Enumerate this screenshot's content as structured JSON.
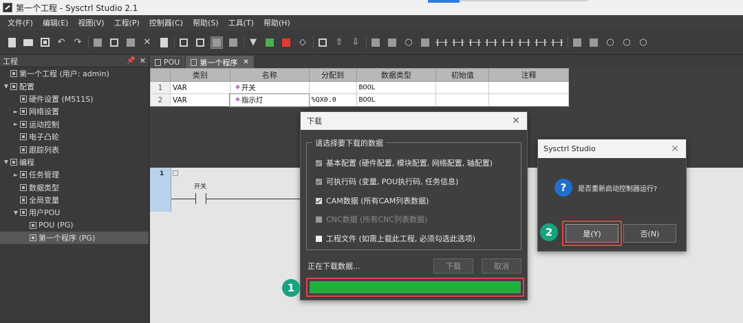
{
  "window": {
    "title": "第一个工程 - Sysctrl Studio 2.1"
  },
  "menu": [
    "文件(F)",
    "编辑(E)",
    "视图(V)",
    "工程(P)",
    "控制器(C)",
    "帮助(S)",
    "工具(T)",
    "帮助(H)"
  ],
  "toolbar_icons": [
    "new-file-icon",
    "open-folder-icon",
    "save-icon",
    "undo-icon",
    "redo-icon",
    "copy-icon",
    "cut-icon",
    "paste-icon",
    "delete-icon",
    "clipboard-icon",
    "build-icon",
    "clean-icon",
    "login-icon",
    "logout-icon",
    "download-icon",
    "run-icon",
    "stop-icon",
    "reset-icon",
    "monitor-icon",
    "step-up-icon",
    "step-down-icon"
  ],
  "project_panel": {
    "title": "工程",
    "items": [
      {
        "label": "第一个工程 (用户: admin)",
        "level": 0,
        "arrow": "",
        "selected": false
      },
      {
        "label": "配置",
        "level": 0,
        "arrow": "▼",
        "selected": false
      },
      {
        "label": "硬件设置 (M511S)",
        "level": 1,
        "arrow": "",
        "selected": false
      },
      {
        "label": "网络设置",
        "level": 1,
        "arrow": "►",
        "selected": false
      },
      {
        "label": "运动控制",
        "level": 1,
        "arrow": "►",
        "selected": false
      },
      {
        "label": "电子凸轮",
        "level": 1,
        "arrow": "",
        "selected": false
      },
      {
        "label": "跟踪列表",
        "level": 1,
        "arrow": "",
        "selected": false
      },
      {
        "label": "编程",
        "level": 0,
        "arrow": "▼",
        "selected": false
      },
      {
        "label": "任务管理",
        "level": 1,
        "arrow": "►",
        "selected": false
      },
      {
        "label": "数据类型",
        "level": 1,
        "arrow": "",
        "selected": false
      },
      {
        "label": "全局变量",
        "level": 1,
        "arrow": "",
        "selected": false
      },
      {
        "label": "用户POU",
        "level": 1,
        "arrow": "▼",
        "selected": false
      },
      {
        "label": "POU (PG)",
        "level": 2,
        "arrow": "",
        "selected": false
      },
      {
        "label": "第一个程序 (PG)",
        "level": 2,
        "arrow": "",
        "selected": true
      }
    ]
  },
  "tabs": [
    {
      "label": "POU",
      "active": false
    },
    {
      "label": "第一个程序",
      "active": true
    }
  ],
  "var_table": {
    "headers": [
      "类别",
      "名称",
      "分配到",
      "数据类型",
      "初始值",
      "注释"
    ],
    "rows": [
      {
        "num": "1",
        "category": "VAR",
        "name": "开关",
        "address": "",
        "type": "BOOL",
        "init": "",
        "comment": ""
      },
      {
        "num": "2",
        "category": "VAR",
        "name": "指示灯",
        "address": "%QX0.0",
        "type": "BOOL",
        "init": "",
        "comment": ""
      }
    ]
  },
  "ladder": {
    "rung_number": "1",
    "contact_label": "开关"
  },
  "download_dialog": {
    "title": "下载",
    "group_title": "请选择要下载的数据",
    "options": [
      {
        "label": "基本配置 (硬件配置, 模块配置, 网络配置, 轴配置)",
        "checked": true,
        "disabled": false,
        "box": "gray"
      },
      {
        "label": "可执行码 (变量, POU执行码, 任务信息)",
        "checked": true,
        "disabled": false,
        "box": "gray"
      },
      {
        "label": "CAM数据 (所有CAM列表数据)",
        "checked": true,
        "disabled": false,
        "box": "white"
      },
      {
        "label": "CNC数据 (所有CNC列表数据)",
        "checked": false,
        "disabled": true,
        "box": "gray"
      },
      {
        "label": "工程文件 (如需上载此工程, 必须勾选此选项)",
        "checked": false,
        "disabled": false,
        "box": "white-solid"
      }
    ],
    "status": "正在下载数据...",
    "download_button": "下载",
    "cancel_button": "取消",
    "progress": 1.0,
    "progress_color": "#19b33a"
  },
  "confirm_dialog": {
    "title": "Sysctrl Studio",
    "message": "是否重新启动控制器运行?",
    "yes_button": "是(Y)",
    "no_button": "否(N)"
  },
  "markers": {
    "step1": "1",
    "step2": "2"
  },
  "colors": {
    "highlight": "#e04545",
    "marker": "#17a382",
    "question_icon": "#1f6fd1"
  }
}
